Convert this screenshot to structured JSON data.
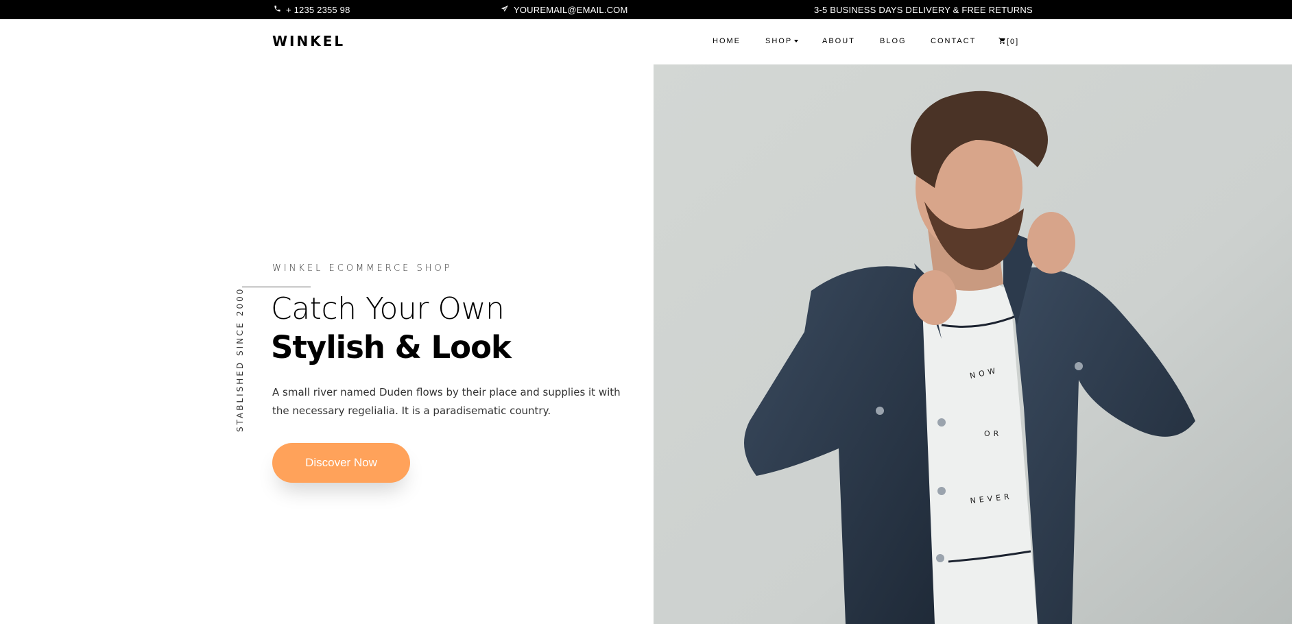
{
  "topbar": {
    "phone": "+ 1235 2355 98",
    "email": "YOUREMAIL@EMAIL.COM",
    "delivery": "3-5 BUSINESS DAYS DELIVERY & FREE RETURNS",
    "phone_icon": "phone-icon",
    "email_icon": "paper-plane-icon"
  },
  "navbar": {
    "brand": "WINKEL",
    "items": [
      {
        "label": "HOME"
      },
      {
        "label": "SHOP"
      },
      {
        "label": "ABOUT"
      },
      {
        "label": "BLOG"
      },
      {
        "label": "CONTACT"
      }
    ],
    "cart_label": "[0]",
    "cart_icon": "cart-icon"
  },
  "hero": {
    "subtitle": "WINKEL ECOMMERCE SHOP",
    "vertical_text": "STABLISHED SINCE 2000",
    "heading_line1": "Catch Your Own",
    "heading_line2": "Stylish & Look",
    "paragraph": "A small river named Duden flows by their place and supplies it with the necessary regelialia. It is a paradisematic country.",
    "button_label": "Discover Now",
    "tshirt_words": [
      "NOW",
      "OR",
      "NEVER"
    ]
  },
  "colors": {
    "accent": "#ffa25a",
    "topbar_bg": "#000000",
    "text": "#000000"
  }
}
